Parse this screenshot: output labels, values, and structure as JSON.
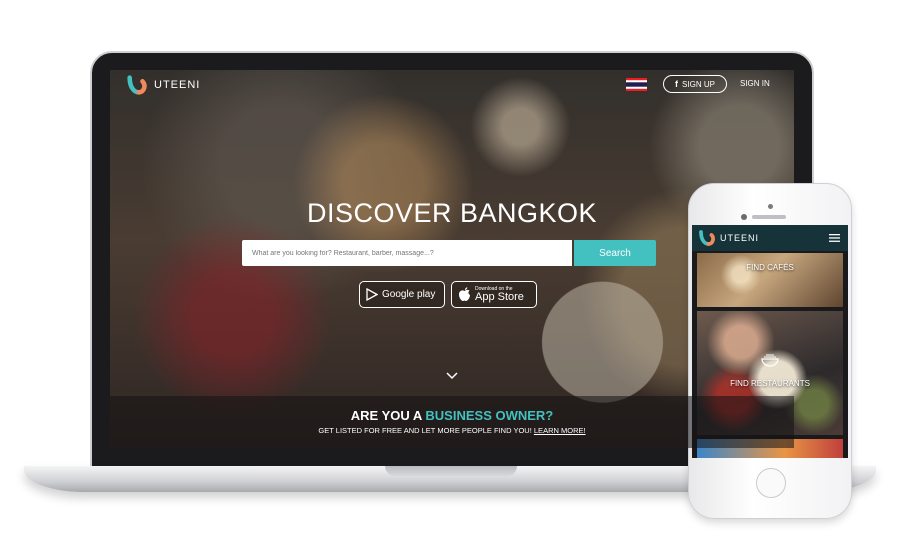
{
  "brand": {
    "name": "UTEENI",
    "accent_color": "#43c1c0",
    "nav_color": "#17333a"
  },
  "desktop": {
    "nav": {
      "flag_icon": "thailand-flag-icon",
      "signup_label": "SIGN UP",
      "signup_icon": "facebook-icon",
      "signin_label": "SIGN IN"
    },
    "hero": {
      "title": "DISCOVER BANGKOK",
      "search_placeholder": "What are you looking for? Restaurant, barber, massage...?",
      "search_button": "Search"
    },
    "stores": {
      "google_play_label": "Google play",
      "app_store_small": "Download on the",
      "app_store_label": "App Store"
    },
    "banner": {
      "title_prefix": "ARE YOU A ",
      "title_accent": "BUSINESS OWNER?",
      "subtitle": "GET LISTED FOR FREE AND LET MORE PEOPLE FIND YOU! ",
      "learn_more": "LEARN MORE!"
    }
  },
  "mobile": {
    "brand": "UTEENI",
    "menu_icon": "hamburger-menu-icon",
    "tiles": [
      {
        "label": "FIND CAFÉS"
      },
      {
        "label": "FIND RESTAURANTS",
        "icon": "bowl-icon"
      },
      {
        "label": ""
      }
    ]
  }
}
